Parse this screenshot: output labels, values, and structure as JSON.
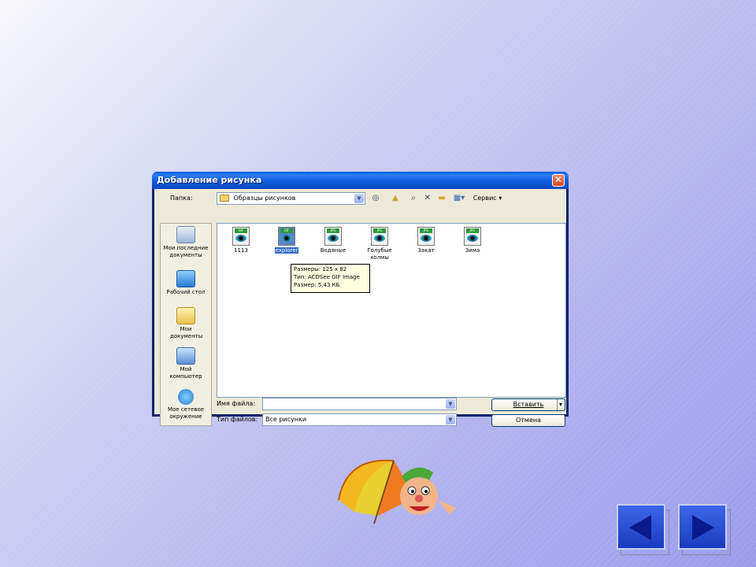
{
  "dialog": {
    "title": "Добавление рисунка",
    "folder_label": "Папка:",
    "folder_value": "Образцы рисунков",
    "service_label": "Сервис",
    "filename_label": "Имя файла:",
    "filename_value": "",
    "filetype_label": "Тип файлов:",
    "filetype_value": "Все рисунки",
    "insert_button": "Вставить",
    "cancel_button": "Отмена"
  },
  "places": [
    {
      "label": "Мои последние документы"
    },
    {
      "label": "Рабочий стол"
    },
    {
      "label": "Мои документы"
    },
    {
      "label": "Мой компьютер"
    },
    {
      "label": "Мое сетевое окружение"
    }
  ],
  "files": [
    {
      "name": "1113",
      "type_tag": "GIF"
    },
    {
      "name": "explorer",
      "type_tag": "GIF"
    },
    {
      "name": "Водяные",
      "type_tag": "JPG"
    },
    {
      "name": "Голубые холмы",
      "type_tag": "JPG"
    },
    {
      "name": "Закат",
      "type_tag": "JPG"
    },
    {
      "name": "Зима",
      "type_tag": "JPG"
    }
  ],
  "tooltip": {
    "line1": "Размеры: 125 x 82",
    "line2": "Тип: ACDSee GIF Image",
    "line3": "Размер: 5,43 КБ"
  },
  "icons": {
    "back": "back-arrow-icon",
    "up": "up-folder-icon",
    "search": "search-icon",
    "delete": "delete-icon",
    "new_folder": "new-folder-icon",
    "views": "views-icon"
  },
  "colors": {
    "title_blue": "#0a5fe0",
    "close_red": "#d84a20",
    "nav_blue": "#1a3cc0"
  }
}
